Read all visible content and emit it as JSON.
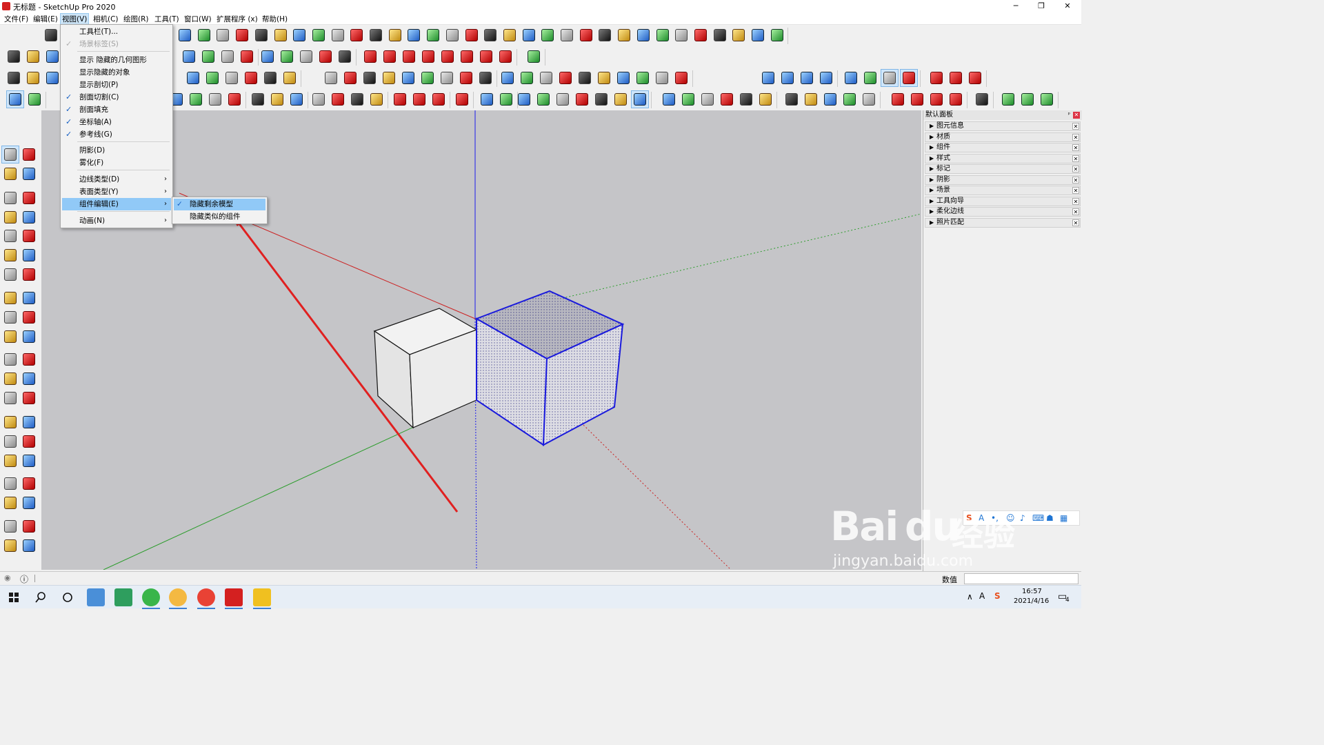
{
  "window": {
    "title": "无标题 - SketchUp Pro 2020",
    "minimize": "─",
    "restore": "❐",
    "close": "✕"
  },
  "menubar": [
    "文件(F)",
    "编辑(E)",
    "视图(V)",
    "相机(C)",
    "绘图(R)",
    "工具(T)",
    "窗口(W)",
    "扩展程序 (x)",
    "帮助(H)"
  ],
  "view_menu": {
    "items": [
      {
        "label": "工具栏(T)...",
        "checked": false,
        "disabled": false,
        "submenu": false
      },
      {
        "label": "场景标签(S)",
        "checked": true,
        "disabled": true,
        "submenu": false
      },
      {
        "label": "显示 隐藏的几何图形",
        "checked": false,
        "disabled": false,
        "submenu": false
      },
      {
        "label": "显示隐藏的对象",
        "checked": false,
        "disabled": false,
        "submenu": false
      },
      {
        "label": "显示剖切(P)",
        "checked": false,
        "disabled": false,
        "submenu": false
      },
      {
        "label": "剖面切割(C)",
        "checked": true,
        "disabled": false,
        "submenu": false
      },
      {
        "label": "剖面填充",
        "checked": true,
        "disabled": false,
        "submenu": false
      },
      {
        "label": "坐标轴(A)",
        "checked": true,
        "disabled": false,
        "submenu": false
      },
      {
        "label": "参考线(G)",
        "checked": true,
        "disabled": false,
        "submenu": false
      },
      {
        "label": "阴影(D)",
        "checked": false,
        "disabled": false,
        "submenu": false
      },
      {
        "label": "雾化(F)",
        "checked": false,
        "disabled": false,
        "submenu": false
      },
      {
        "label": "边线类型(D)",
        "checked": false,
        "disabled": false,
        "submenu": true
      },
      {
        "label": "表面类型(Y)",
        "checked": false,
        "disabled": false,
        "submenu": true
      },
      {
        "label": "组件编辑(E)",
        "checked": false,
        "disabled": false,
        "submenu": true,
        "highlighted": true
      },
      {
        "label": "动画(N)",
        "checked": false,
        "disabled": false,
        "submenu": true
      }
    ]
  },
  "component_submenu": [
    {
      "label": "隐藏剩余模型",
      "checked": true,
      "highlighted": true
    },
    {
      "label": "隐藏类似的组件",
      "checked": false,
      "highlighted": false
    }
  ],
  "tray": {
    "title": "默认面板",
    "pin": "ᵖ",
    "close": "✕",
    "sections": [
      "图元信息",
      "材质",
      "组件",
      "样式",
      "标记",
      "阴影",
      "场景",
      "工具向导",
      "柔化边线",
      "照片匹配"
    ]
  },
  "status": {
    "measure_label": "数值",
    "info_icon": "ⓘ"
  },
  "taskbar": {
    "time": "16:57",
    "date": "2021/4/16",
    "notif": "4",
    "ime": "A"
  },
  "watermark": {
    "brand": "Bai",
    "brand2": "du",
    "cn": "经验",
    "url": "jingyan.baidu.com"
  },
  "colors": {
    "selection": "#1a1adc",
    "axis_red": "#cc2020",
    "axis_green": "#2a9c2a",
    "axis_blue": "#1a1aee",
    "annotation_arrow": "#e02020",
    "menu_highlight": "#91c9f7"
  },
  "icons": {
    "check": "✓",
    "arrow": "›",
    "tri": "▶"
  }
}
